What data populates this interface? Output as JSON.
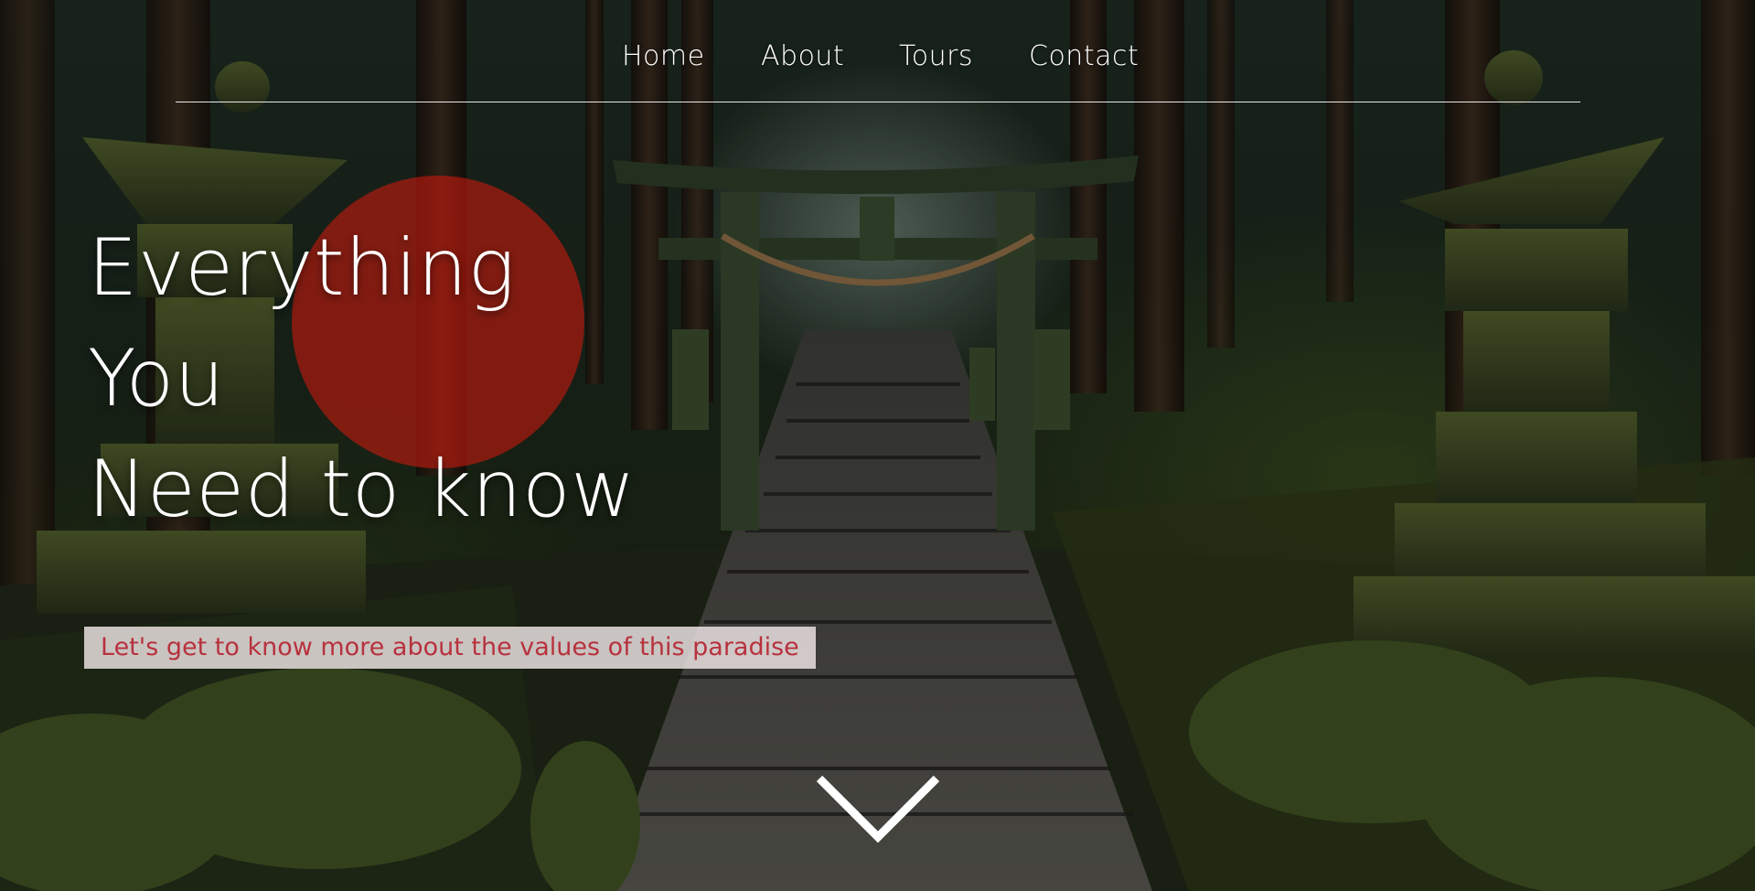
{
  "nav": {
    "items": [
      {
        "label": "Home"
      },
      {
        "label": "About"
      },
      {
        "label": "Tours"
      },
      {
        "label": "Contact"
      }
    ]
  },
  "hero": {
    "headline_lines": [
      "Everything",
      "You",
      "Need to know"
    ],
    "tagline": "Let's get to know more about the values of this paradise",
    "scroll_icon": "chevron-down-icon"
  },
  "colors": {
    "accent_circle": "#c41a0e",
    "tagline_text": "#b7323e",
    "tagline_bg": "#f0e8e8",
    "text": "#ffffff"
  }
}
